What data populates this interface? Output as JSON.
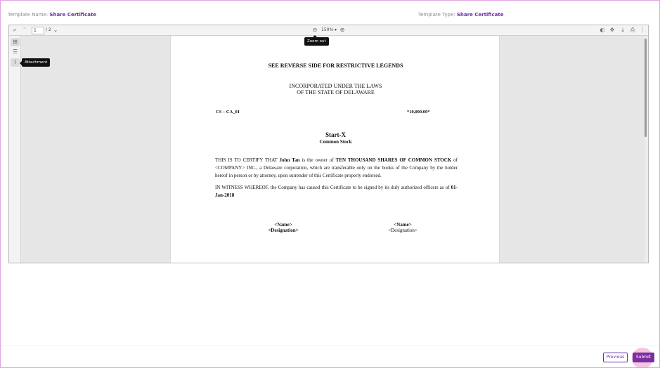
{
  "header": {
    "template_name_label": "Template Name:",
    "template_name_value": "Share Certificate",
    "template_type_label": "Template Type:",
    "template_type_value": "Share Certificate"
  },
  "toolbar": {
    "current_page": "1",
    "page_total": "/ 2",
    "zoom_level": "150% ▾",
    "icons_left": [
      "search-icon",
      "chevron-up-icon",
      "chevron-down-icon"
    ],
    "icons_center": [
      "zoom-out-icon",
      "zoom-in-icon"
    ],
    "icons_right": [
      "contrast-icon",
      "pan-icon",
      "download-icon",
      "print-icon",
      "more-icon"
    ]
  },
  "sidebar": {
    "icons": [
      "thumbnails-icon",
      "outline-icon",
      "attachment-icon"
    ]
  },
  "tooltips": {
    "zoom_out": "Zoom out",
    "attachment": "Attachment"
  },
  "document": {
    "legend": "SEE REVERSE SIDE FOR RESTRICTIVE LEGENDS",
    "incorporated_line1": "INCORPORATED UNDER THE LAWS",
    "incorporated_line2": "OF THE STATE OF DELAWARE",
    "certificate_number": "CS – CA_01",
    "share_count": "*10,000.00*",
    "company_name": "Start-X",
    "stock_class": "Common Stock",
    "para1_a": "THIS IS TO CERTIFY THAT ",
    "para1_holder": "John Tan",
    "para1_b": " is the owner of ",
    "para1_shares": "TEN THOUSAND SHARES OF COMMON STOCK",
    "para1_c": " of <COMPANY> INC., a Delaware corporation, which are transferable only on the books of the Company by the holder hereof in person or by attorney, upon surrender of this Certificate properly endorsed.",
    "para2_a": "IN WITNESS WHEREOF, the Company has caused this Certificate to be signed by its duly authorized officers as of ",
    "para2_date": "01-Jan-2018",
    "sig_name": "<Name>",
    "sig_designation": "<Designation>"
  },
  "footer": {
    "previous_label": "Previous",
    "submit_label": "Submit"
  },
  "colors": {
    "accent": "#6b2fa6",
    "submit_bg": "#7a2f9e"
  }
}
